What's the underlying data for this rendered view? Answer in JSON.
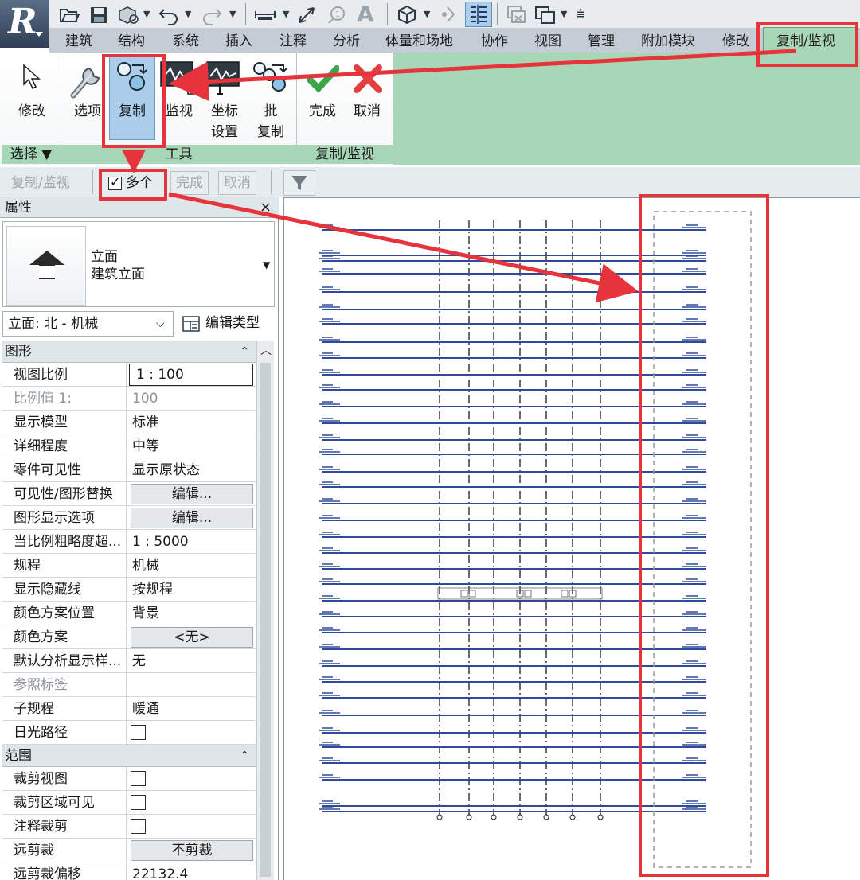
{
  "ribbon": {
    "tabs": [
      "建筑",
      "结构",
      "系统",
      "插入",
      "注释",
      "分析",
      "体量和场地",
      "协作",
      "视图",
      "管理",
      "附加模块",
      "修改",
      "复制/监视"
    ],
    "buttons": {
      "modify": "修改",
      "options": "选项",
      "copy": "复制",
      "monitor": "监视",
      "coord_line1": "坐标",
      "coord_line2": "设置",
      "batch_line1": "批",
      "batch_line2": "复制",
      "finish": "完成",
      "cancel": "取消"
    },
    "panels": {
      "select": "选择 ▼",
      "tools": "工具",
      "copy_monitor": "复制/监视"
    }
  },
  "options_bar": {
    "context": "复制/监视",
    "multiple_label": "多个",
    "multiple_checked": true,
    "finish": "完成",
    "cancel": "取消"
  },
  "properties": {
    "title": "属性",
    "close": "×",
    "type_line1": "立面",
    "type_line2": "建筑立面",
    "instance": "立面: 北 - 机械",
    "edit_type": "编辑类型",
    "groups": [
      {
        "name": "图形",
        "rows": [
          {
            "label": "视图比例",
            "value": "1 : 100",
            "kind": "input"
          },
          {
            "label": "比例值 1:",
            "value": "100",
            "kind": "dim"
          },
          {
            "label": "显示模型",
            "value": "标准"
          },
          {
            "label": "详细程度",
            "value": "中等"
          },
          {
            "label": "零件可见性",
            "value": "显示原状态"
          },
          {
            "label": "可见性/图形替换",
            "value": "编辑...",
            "kind": "btn"
          },
          {
            "label": "图形显示选项",
            "value": "编辑...",
            "kind": "btn"
          },
          {
            "label": "当比例粗略度超...",
            "value": "1 : 5000"
          },
          {
            "label": "规程",
            "value": "机械"
          },
          {
            "label": "显示隐藏线",
            "value": "按规程"
          },
          {
            "label": "颜色方案位置",
            "value": "背景"
          },
          {
            "label": "颜色方案",
            "value": "<无>",
            "kind": "btn"
          },
          {
            "label": "默认分析显示样...",
            "value": "无"
          },
          {
            "label": "参照标签",
            "value": "",
            "kind": "dim"
          },
          {
            "label": "子规程",
            "value": "暖通"
          },
          {
            "label": "日光路径",
            "value": "",
            "kind": "check",
            "checked": false
          }
        ]
      },
      {
        "name": "范围",
        "rows": [
          {
            "label": "裁剪视图",
            "value": "",
            "kind": "check",
            "checked": false
          },
          {
            "label": "裁剪区域可见",
            "value": "",
            "kind": "check",
            "checked": false
          },
          {
            "label": "注释裁剪",
            "value": "",
            "kind": "check",
            "checked": false
          },
          {
            "label": "远剪裁",
            "value": "不剪裁",
            "kind": "btn"
          },
          {
            "label": "远剪裁偏移",
            "value": "22132.4"
          }
        ]
      }
    ]
  },
  "colors": {
    "accent_green": "#a8d7b8",
    "highlight_red": "#e6343c",
    "level_line_blue": "#2f4a9c",
    "selected_button": "#a9cdea"
  },
  "icons": {
    "app": "revit-r-icon",
    "open": "open-folder-icon",
    "save": "save-icon",
    "sync": "sync-icon",
    "undo": "undo-icon",
    "redo": "redo-icon",
    "measure": "measure-icon",
    "dimension": "aligned-dimension-icon",
    "tag": "tag-icon",
    "text": "text-icon",
    "view3d": "default-3d-view-icon",
    "section": "section-icon",
    "thin_lines": "thin-lines-icon",
    "close_hidden": "close-hidden-windows-icon",
    "switch_windows": "switch-windows-icon",
    "customize": "customize-qat-icon",
    "filter": "filter-icon"
  }
}
